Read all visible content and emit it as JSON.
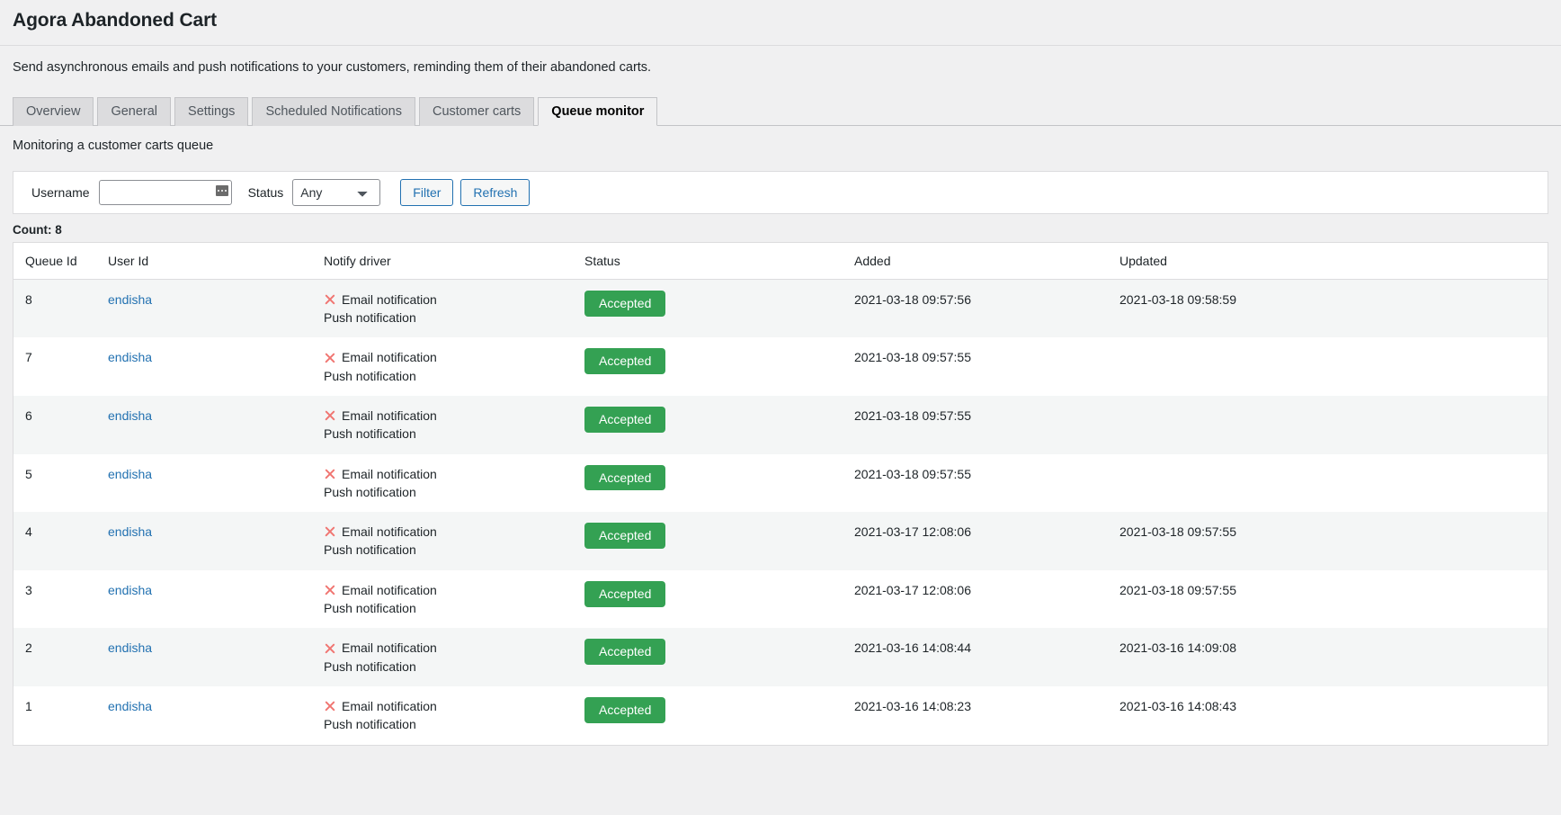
{
  "header": {
    "title": "Agora Abandoned Cart",
    "intro": "Send asynchronous emails and push notifications to your customers, reminding them of their abandoned carts."
  },
  "tabs": [
    {
      "label": "Overview",
      "active": false
    },
    {
      "label": "General",
      "active": false
    },
    {
      "label": "Settings",
      "active": false
    },
    {
      "label": "Scheduled Notifications",
      "active": false
    },
    {
      "label": "Customer carts",
      "active": false
    },
    {
      "label": "Queue monitor",
      "active": true
    }
  ],
  "subtitle": "Monitoring a customer carts queue",
  "filter_bar": {
    "username_label": "Username",
    "username_value": "",
    "username_placeholder": "",
    "username_field_icon": "autocomplete-icon",
    "status_label": "Status",
    "status_selected": "Any",
    "status_options": [
      "Any"
    ],
    "filter_button": "Filter",
    "refresh_button": "Refresh"
  },
  "count_label": "Count: 8",
  "table": {
    "columns": [
      "Queue Id",
      "User Id",
      "Notify driver",
      "Status",
      "Added",
      "Updated"
    ],
    "rows": [
      {
        "queue_id": "8",
        "user_id": "endisha",
        "driver_email": "Email notification",
        "driver_push": "Push notification",
        "status": "Accepted",
        "added": "2021-03-18 09:57:56",
        "updated": "2021-03-18 09:58:59"
      },
      {
        "queue_id": "7",
        "user_id": "endisha",
        "driver_email": "Email notification",
        "driver_push": "Push notification",
        "status": "Accepted",
        "added": "2021-03-18 09:57:55",
        "updated": ""
      },
      {
        "queue_id": "6",
        "user_id": "endisha",
        "driver_email": "Email notification",
        "driver_push": "Push notification",
        "status": "Accepted",
        "added": "2021-03-18 09:57:55",
        "updated": ""
      },
      {
        "queue_id": "5",
        "user_id": "endisha",
        "driver_email": "Email notification",
        "driver_push": "Push notification",
        "status": "Accepted",
        "added": "2021-03-18 09:57:55",
        "updated": ""
      },
      {
        "queue_id": "4",
        "user_id": "endisha",
        "driver_email": "Email notification",
        "driver_push": "Push notification",
        "status": "Accepted",
        "added": "2021-03-17 12:08:06",
        "updated": "2021-03-18 09:57:55"
      },
      {
        "queue_id": "3",
        "user_id": "endisha",
        "driver_email": "Email notification",
        "driver_push": "Push notification",
        "status": "Accepted",
        "added": "2021-03-17 12:08:06",
        "updated": "2021-03-18 09:57:55"
      },
      {
        "queue_id": "2",
        "user_id": "endisha",
        "driver_email": "Email notification",
        "driver_push": "Push notification",
        "status": "Accepted",
        "added": "2021-03-16 14:08:44",
        "updated": "2021-03-16 14:09:08"
      },
      {
        "queue_id": "1",
        "user_id": "endisha",
        "driver_email": "Email notification",
        "driver_push": "Push notification",
        "status": "Accepted",
        "added": "2021-03-16 14:08:23",
        "updated": "2021-03-16 14:08:43"
      }
    ]
  },
  "colors": {
    "accent_link": "#2271b1",
    "badge_accepted": "#34a153",
    "error_icon": "#f07672",
    "page_bg": "#f0f0f1",
    "stripe_bg": "#f4f6f6"
  }
}
